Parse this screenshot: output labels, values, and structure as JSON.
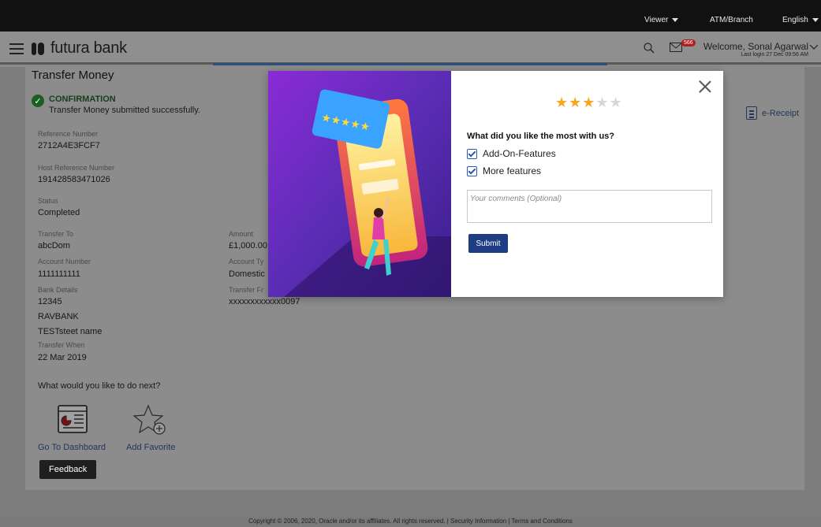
{
  "topbar": {
    "viewer": "Viewer",
    "atm_branch": "ATM/Branch",
    "language": "English"
  },
  "header": {
    "brand": "futura bank",
    "mail_badge": "566",
    "welcome": "Welcome, Sonal Agarwal",
    "last_login": "Last login 27 Dec 09:56 AM"
  },
  "page": {
    "title": "Transfer Money",
    "confirmation_title": "CONFIRMATION",
    "confirmation_message": "Transfer Money submitted successfully.",
    "ereceipt": "e-Receipt",
    "fields": {
      "ref_label": "Reference Number",
      "ref_value": "2712A4E3FCF7",
      "host_label": "Host Reference Number",
      "host_value": "191428583471026",
      "status_label": "Status",
      "status_value": "Completed",
      "to_label": "Transfer To",
      "to_value": "abcDom",
      "amount_label": "Amount",
      "amount_value": "£1,000.00",
      "acct_label": "Account Number",
      "acct_value": "1111111111",
      "acct_type_label": "Account Ty",
      "acct_type_value": "Domestic",
      "bank_label": "Bank Details",
      "bank_line1": "12345",
      "bank_line2": "RAVBANK",
      "bank_line3": "TESTsteet name",
      "from_label": "Transfer Fr",
      "from_value": "xxxxxxxxxxxx0097",
      "when_label": "Transfer When",
      "when_value": "22 Mar 2019"
    },
    "next_question": "What would you like to do next?",
    "actions": {
      "dashboard": "Go To Dashboard",
      "favorite": "Add Favorite"
    },
    "feedback": "Feedback"
  },
  "modal": {
    "rating": 3,
    "rating_max": 5,
    "question": "What did you like the most with us?",
    "options": [
      {
        "label": "Add-On-Features",
        "checked": true
      },
      {
        "label": "More features",
        "checked": true
      }
    ],
    "comments_placeholder": "Your comments (Optional)",
    "submit": "Submit"
  },
  "footer": "Copyright © 2006, 2020, Oracle and/or its affiliates. All rights reserved. | Security Information | Terms and Conditions"
}
